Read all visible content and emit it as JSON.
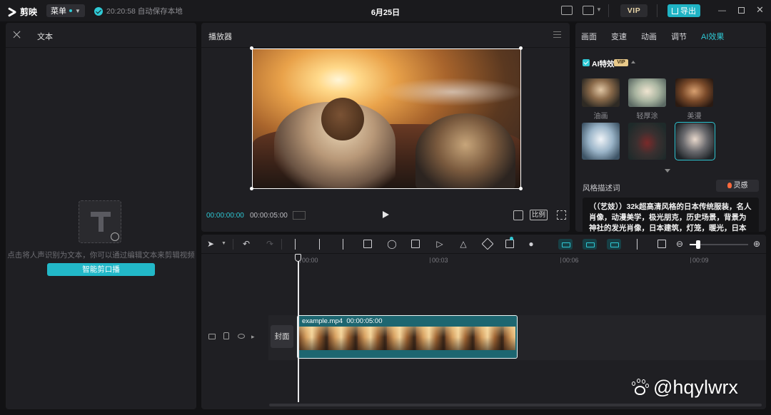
{
  "app": {
    "name": "剪映",
    "menu_label": "菜单",
    "save_status": "20:20:58 自动保存本地",
    "project_title": "6月25日",
    "vip_label": "VIP",
    "export_label": "导出"
  },
  "left_panel": {
    "title": "文本",
    "hint": "点击将人声识别为文本，你可以通过编辑文本来剪辑视频",
    "smart_button": "智能剪口播"
  },
  "player": {
    "title": "播放器",
    "current_time": "00:00:00:00",
    "total_time": "00:00:05:00",
    "ratio_label": "比例"
  },
  "right_panel": {
    "tabs": [
      {
        "label": "画面",
        "active": false
      },
      {
        "label": "变速",
        "active": false
      },
      {
        "label": "动画",
        "active": false
      },
      {
        "label": "调节",
        "active": false
      },
      {
        "label": "AI效果",
        "active": true
      }
    ],
    "ai_effect_label": "AI特效",
    "vip_badge": "VIP",
    "styles": [
      {
        "label": "油画",
        "selected": false
      },
      {
        "label": "轻厚涂",
        "selected": false
      },
      {
        "label": "美漫",
        "selected": false
      },
      {
        "label": "",
        "selected": false
      },
      {
        "label": "",
        "selected": false
      },
      {
        "label": "",
        "selected": true
      }
    ],
    "style_desc_label": "风格描述词",
    "inspire_label": "灵感",
    "prompt_text": "（（艺妓））32k超高清风格的日本传统服装，名人肖像，动漫美学，极光朋克，历史场景，背景为神社的发光肖像，日本建筑，灯笼，暖光，日本灯笼"
  },
  "timeline": {
    "ruler_labels": [
      "00:00",
      "00:03",
      "00:06",
      "00:09"
    ],
    "cover_label": "封面",
    "clip": {
      "filename": "example.mp4",
      "duration": "00:00:05:00"
    }
  },
  "watermark": "@hqylwrx",
  "colors": {
    "accent": "#2fc9d5",
    "export": "#1fb3c4",
    "clip": "#1d6670"
  }
}
